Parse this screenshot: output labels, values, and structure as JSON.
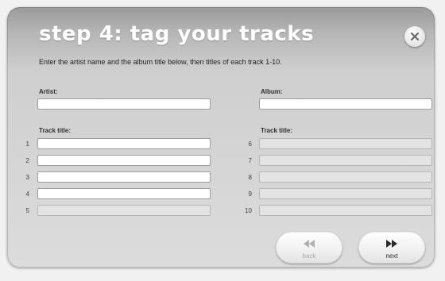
{
  "dialog": {
    "title": "step 4: tag your tracks",
    "subtitle": "Enter the artist name and the album title below, then titles of each track 1-10."
  },
  "form": {
    "artist_label": "Artist:",
    "album_label": "Album:",
    "track_title_label_left": "Track title:",
    "track_title_label_right": "Track title:",
    "artist_value": "",
    "album_value": "",
    "tracks": [
      {
        "number": "1",
        "value": "",
        "enabled": true
      },
      {
        "number": "2",
        "value": "",
        "enabled": true
      },
      {
        "number": "3",
        "value": "",
        "enabled": true
      },
      {
        "number": "4",
        "value": "",
        "enabled": true
      },
      {
        "number": "5",
        "value": "",
        "enabled": false
      },
      {
        "number": "6",
        "value": "",
        "enabled": false
      },
      {
        "number": "7",
        "value": "",
        "enabled": false
      },
      {
        "number": "8",
        "value": "",
        "enabled": false
      },
      {
        "number": "9",
        "value": "",
        "enabled": false
      },
      {
        "number": "10",
        "value": "",
        "enabled": false
      }
    ]
  },
  "buttons": {
    "back_label": "back",
    "next_label": "next",
    "back_icon": "rewind-icon",
    "next_icon": "fast-forward-icon",
    "close_icon": "close-icon"
  },
  "colors": {
    "title": "#ffffff",
    "back_disabled": "#a8a8a8",
    "next": "#2a2a2a"
  }
}
